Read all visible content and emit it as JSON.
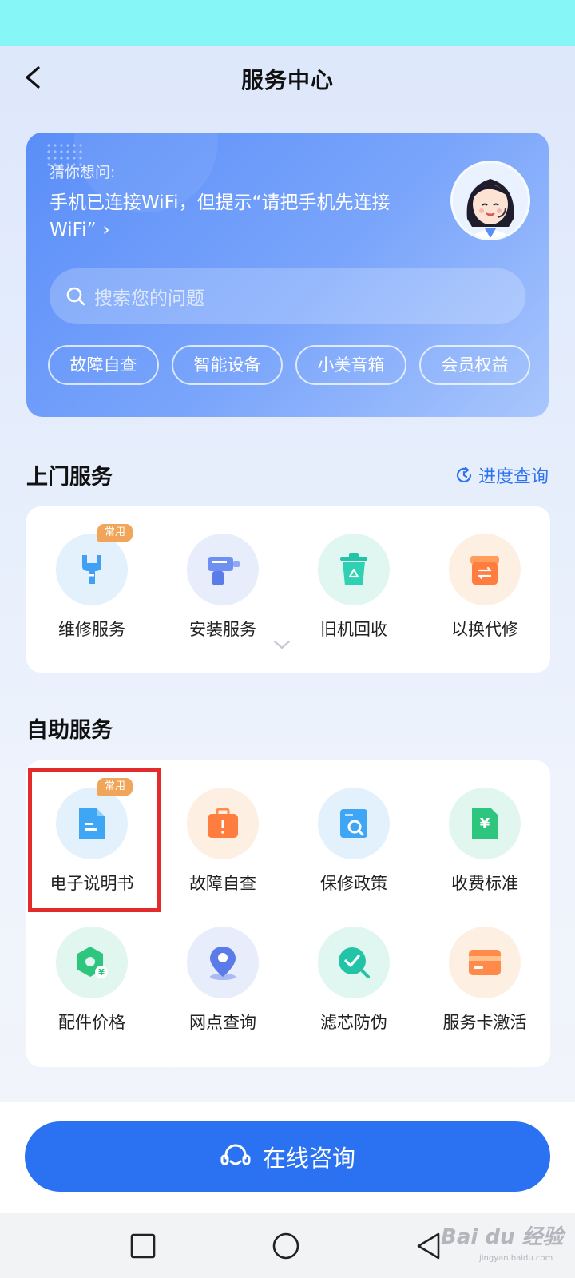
{
  "header": {
    "title": "服务中心"
  },
  "hero": {
    "hint": "猜你想问:",
    "question": "手机已连接WiFi，但提示“请把手机先连接WiFi”",
    "chevron": "›",
    "search_placeholder": "搜索您的问题",
    "chips": [
      "故障自查",
      "智能设备",
      "小美音箱",
      "会员权益"
    ]
  },
  "home_service": {
    "title": "上门服务",
    "progress_link": "进度查询",
    "items": [
      {
        "label": "维修服务",
        "icon": "wrench-icon",
        "badge": "常用"
      },
      {
        "label": "安装服务",
        "icon": "drill-icon"
      },
      {
        "label": "旧机回收",
        "icon": "recycle-bin-icon"
      },
      {
        "label": "以换代修",
        "icon": "exchange-box-icon"
      }
    ]
  },
  "self_service": {
    "title": "自助服务",
    "items": [
      {
        "label": "电子说明书",
        "icon": "document-icon",
        "badge": "常用"
      },
      {
        "label": "故障自查",
        "icon": "toolbox-icon"
      },
      {
        "label": "保修政策",
        "icon": "warranty-icon"
      },
      {
        "label": "收费标准",
        "icon": "yuan-icon"
      },
      {
        "label": "配件价格",
        "icon": "part-price-icon"
      },
      {
        "label": "网点查询",
        "icon": "location-pin-icon"
      },
      {
        "label": "滤芯防伪",
        "icon": "check-search-icon"
      },
      {
        "label": "服务卡激活",
        "icon": "card-icon"
      }
    ]
  },
  "consult": {
    "label": "在线咨询"
  },
  "watermark": {
    "main": "Bai du 经验",
    "sub": "jingyan.baidu.com"
  },
  "colors": {
    "accent": "#2b72f3",
    "highlight": "#e32b2b",
    "badge": "#f0a55a"
  }
}
